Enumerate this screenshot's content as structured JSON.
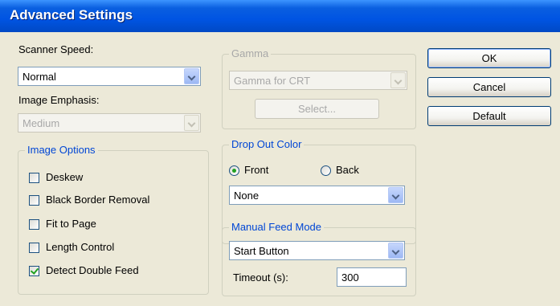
{
  "window": {
    "title": "Advanced Settings"
  },
  "scanner_speed": {
    "label": "Scanner Speed:",
    "value": "Normal"
  },
  "image_emphasis": {
    "label": "Image Emphasis:",
    "value": "Medium"
  },
  "image_options": {
    "legend": "Image Options",
    "items": [
      {
        "label": "Deskew",
        "checked": false
      },
      {
        "label": "Black Border Removal",
        "checked": false
      },
      {
        "label": "Fit to Page",
        "checked": false
      },
      {
        "label": "Length Control",
        "checked": false
      },
      {
        "label": "Detect Double Feed",
        "checked": true
      }
    ]
  },
  "gamma": {
    "legend": "Gamma",
    "value": "Gamma for CRT",
    "select_label": "Select..."
  },
  "drop_out_color": {
    "legend": "Drop Out Color",
    "front_label": "Front",
    "back_label": "Back",
    "selected": "Front",
    "value": "None"
  },
  "manual_feed": {
    "legend": "Manual Feed Mode",
    "value": "Start Button",
    "timeout_label": "Timeout (s):",
    "timeout_value": "300"
  },
  "buttons": {
    "ok": "OK",
    "cancel": "Cancel",
    "default": "Default"
  }
}
